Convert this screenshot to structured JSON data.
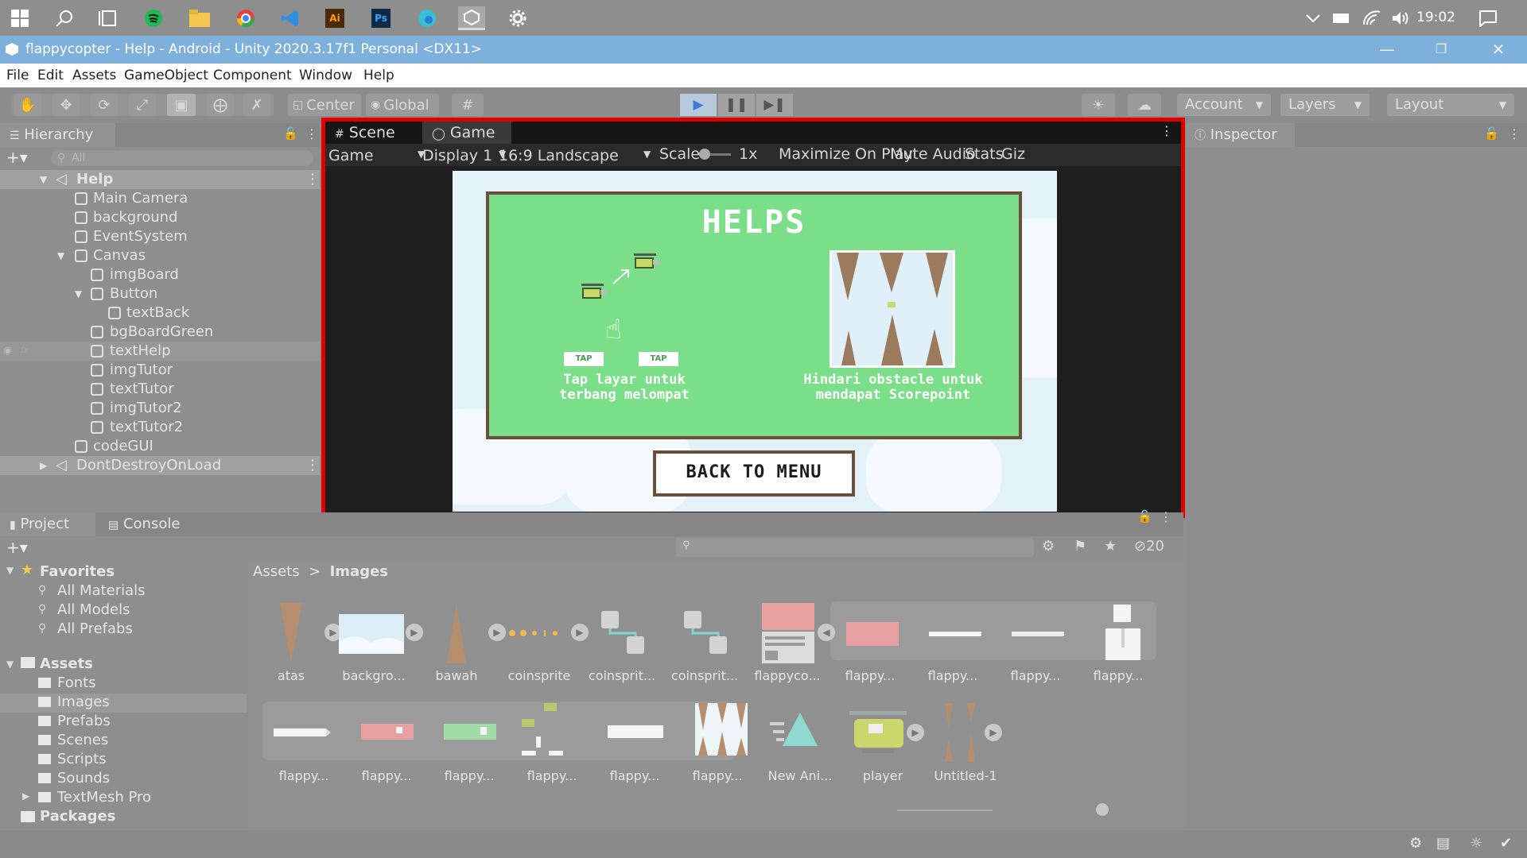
{
  "taskbar": {
    "clock": "19:02",
    "apps": [
      "windows-start-icon",
      "search-icon",
      "task-view-icon",
      "spotify-icon",
      "file-explorer-icon",
      "chrome-icon",
      "vscode-icon",
      "illustrator-icon",
      "photoshop-icon",
      "edge-icon",
      "unity-icon",
      "settings-icon"
    ]
  },
  "window": {
    "title": "flappycopter - Help - Android - Unity 2020.3.17f1 Personal <DX11>"
  },
  "menu": [
    "File",
    "Edit",
    "Assets",
    "GameObject",
    "Component",
    "Window",
    "Help"
  ],
  "toolbar": {
    "pivot": "Center",
    "space": "Global",
    "account": "Account",
    "layers": "Layers",
    "layout": "Layout"
  },
  "hierarchy": {
    "tab": "Hierarchy",
    "search_placeholder": "All",
    "items": [
      {
        "label": "Help"
      },
      {
        "label": "Main Camera"
      },
      {
        "label": "background"
      },
      {
        "label": "EventSystem"
      },
      {
        "label": "Canvas"
      },
      {
        "label": "imgBoard"
      },
      {
        "label": "Button"
      },
      {
        "label": "textBack"
      },
      {
        "label": "bgBoardGreen"
      },
      {
        "label": "textHelp"
      },
      {
        "label": "imgTutor"
      },
      {
        "label": "textTutor"
      },
      {
        "label": "imgTutor2"
      },
      {
        "label": "textTutor2"
      },
      {
        "label": "codeGUI"
      },
      {
        "label": "DontDestroyOnLoad"
      }
    ]
  },
  "game_view": {
    "tabs": [
      "Scene",
      "Game"
    ],
    "mode": "Game",
    "display": "Display 1",
    "aspect": "16:9 Landscape",
    "scale_label": "Scale",
    "scale_value": "1x",
    "maximize": "Maximize On Play",
    "mute": "Mute Audio",
    "stats": "Stats",
    "gizmos": "Giz",
    "content": {
      "title": "HELPS",
      "tap_left": "TAP",
      "tap_right": "TAP",
      "tutor1_line1": "Tap layar untuk",
      "tutor1_line2": "terbang melompat",
      "tutor2_line1": "Hindari obstacle untuk",
      "tutor2_line2": "mendapat Scorepoint",
      "back_button": "BACK TO MENU"
    }
  },
  "inspector": {
    "tab": "Inspector"
  },
  "project": {
    "tabs": [
      "Project",
      "Console"
    ],
    "hidden_count": "20",
    "breadcrumb": [
      "Assets",
      "Images"
    ],
    "favorites": {
      "title": "Favorites",
      "items": [
        "All Materials",
        "All Models",
        "All Prefabs"
      ]
    },
    "assets_tree": {
      "title": "Assets",
      "items": [
        "Fonts",
        "Images",
        "Prefabs",
        "Scenes",
        "Scripts",
        "Sounds",
        "TextMesh Pro"
      ],
      "packages": "Packages"
    },
    "assets_row1": [
      "atas",
      "backgro...",
      "bawah",
      "coinsprite",
      "coinsprit...",
      "coinsprit...",
      "flappyco...",
      "flappy...",
      "flappy...",
      "flappy...",
      "flappy..."
    ],
    "assets_row2": [
      "flappy...",
      "flappy...",
      "flappy...",
      "flappy...",
      "flappy...",
      "flappy...",
      "New Ani...",
      "player",
      "Untitled-1"
    ]
  }
}
